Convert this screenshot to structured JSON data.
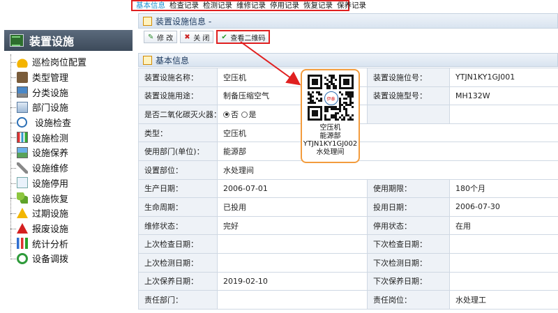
{
  "tabs": [
    {
      "label": "基本信息",
      "active": true
    },
    {
      "label": "检查记录",
      "active": false
    },
    {
      "label": "检测记录",
      "active": false
    },
    {
      "label": "维修记录",
      "active": false
    },
    {
      "label": "停用记录",
      "active": false
    },
    {
      "label": "恢复记录",
      "active": false
    },
    {
      "label": "保养记录",
      "active": false
    }
  ],
  "sidebar": {
    "title": "装置设施",
    "items": [
      {
        "label": "巡检岗位配置",
        "icon": "helmet-icon"
      },
      {
        "label": "类型管理",
        "icon": "type-icon"
      },
      {
        "label": "分类设施",
        "icon": "computer-icon"
      },
      {
        "label": "部门设施",
        "icon": "department-icon"
      },
      {
        "label": "设施检查",
        "icon": "magnifier-icon"
      },
      {
        "label": "设施检测",
        "icon": "chart-icon"
      },
      {
        "label": "设施保养",
        "icon": "picture-icon"
      },
      {
        "label": "设施维修",
        "icon": "wrench-icon"
      },
      {
        "label": "设施停用",
        "icon": "edit-icon"
      },
      {
        "label": "设施恢复",
        "icon": "puzzle-icon"
      },
      {
        "label": "过期设施",
        "icon": "warning-icon"
      },
      {
        "label": "报废设施",
        "icon": "warning-red-icon"
      },
      {
        "label": "统计分析",
        "icon": "bar-chart-icon"
      },
      {
        "label": "设备调拨",
        "icon": "sync-icon"
      }
    ]
  },
  "panel": {
    "title": "装置设施信息 -",
    "buttons": {
      "edit": "修 改",
      "close": "关 闭",
      "qr": "查看二维码"
    },
    "section_title": "基本信息"
  },
  "form": {
    "rows": [
      [
        {
          "label": "装置设施名称：",
          "value": "空压机"
        },
        {
          "label": "装置设施位号：",
          "value": "YTJN1KY1GJ001"
        }
      ],
      [
        {
          "label": "装置设施用途：",
          "value": "制备压缩空气"
        },
        {
          "label": "装置设施型号：",
          "value": "MH132W"
        }
      ],
      [
        {
          "label": "是否二氧化碳灭火器：",
          "value": ""
        },
        {
          "label": "",
          "value": ""
        }
      ],
      [
        {
          "label": "类型：",
          "value": "空压机"
        }
      ],
      [
        {
          "label": "使用部门(单位)：",
          "value": "能源部"
        }
      ],
      [
        {
          "label": "设置部位：",
          "value": "水处理间"
        }
      ],
      [
        {
          "label": "生产日期：",
          "value": "2006-07-01"
        },
        {
          "label": "使用期限：",
          "value": "180个月"
        }
      ],
      [
        {
          "label": "生命周期：",
          "value": "已投用"
        },
        {
          "label": "投用日期：",
          "value": "2006-07-30"
        }
      ],
      [
        {
          "label": "维修状态：",
          "value": "完好"
        },
        {
          "label": "停用状态：",
          "value": "在用"
        }
      ],
      [
        {
          "label": "上次检查日期：",
          "value": ""
        },
        {
          "label": "下次检查日期：",
          "value": ""
        }
      ],
      [
        {
          "label": "上次检测日期：",
          "value": ""
        },
        {
          "label": "下次检测日期：",
          "value": ""
        }
      ],
      [
        {
          "label": "上次保养日期：",
          "value": "2019-02-10"
        },
        {
          "label": "下次保养日期：",
          "value": ""
        }
      ],
      [
        {
          "label": "责任部门：",
          "value": ""
        },
        {
          "label": "责任岗位：",
          "value": "水处理工"
        }
      ]
    ],
    "co2_options": {
      "no": "否",
      "yes": "是",
      "selected": "no"
    },
    "required_mark": "*"
  },
  "qr_popup": {
    "logo_text": "伊泰",
    "lines": [
      "空压机",
      "能源部",
      "YTJN1KY1GJ002",
      "水处理间"
    ]
  },
  "colors": {
    "highlight": "#e02020",
    "popup_border": "#f39c3d",
    "active_tab": "#1a8fd0"
  }
}
